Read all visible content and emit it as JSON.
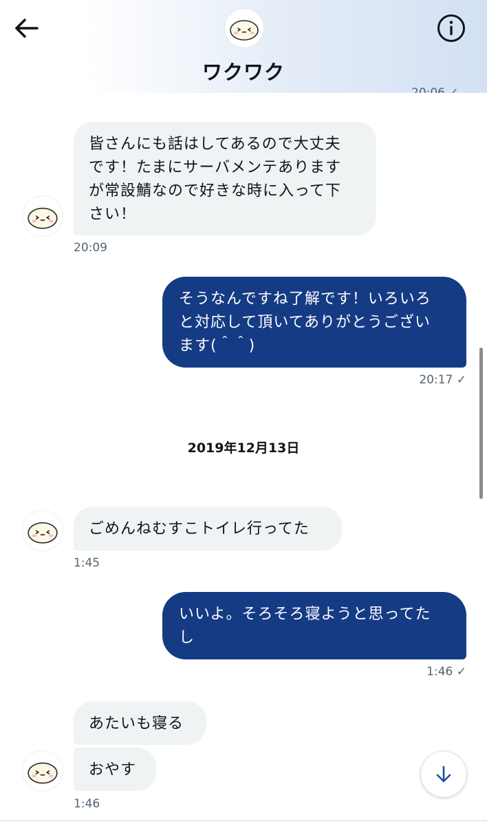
{
  "header": {
    "title": "ワクワク",
    "back_icon": "arrow-left-icon",
    "info_icon": "info-circle-icon",
    "avatar_icon": "mochi-face-icon"
  },
  "messages": [
    {
      "side": "out",
      "time": "20:06 ✓",
      "partial": true
    },
    {
      "side": "in",
      "text": "皆さんにも話はしてあるので大丈夫\nです！たまにサーバメンテあります\nが常設鯖なので好きな時に入って下\nさい！",
      "time": "20:09"
    },
    {
      "side": "out",
      "text": "そうなんですね了解です！いろいろ\nと対応して頂いてありがとうござい\nます(＾＾)",
      "time": "20:17 ✓"
    },
    {
      "side": "in",
      "text": "ごめんねむすこトイレ行ってた",
      "time": "1:45"
    },
    {
      "side": "out",
      "text": "いいよ。そろそろ寝ようと思ってた\nし",
      "time": "1:46 ✓"
    },
    {
      "side": "in",
      "text": "あたいも寝る"
    },
    {
      "side": "in",
      "text": "おやす",
      "time": "1:46"
    }
  ],
  "date_separator": "2019年12月13日",
  "scroll_down_icon": "arrow-down-icon",
  "colors": {
    "outgoing_bubble": "#163b85",
    "incoming_bubble": "#eff3f4",
    "time_text": "#536471",
    "fab_arrow": "#1d4fa0"
  }
}
